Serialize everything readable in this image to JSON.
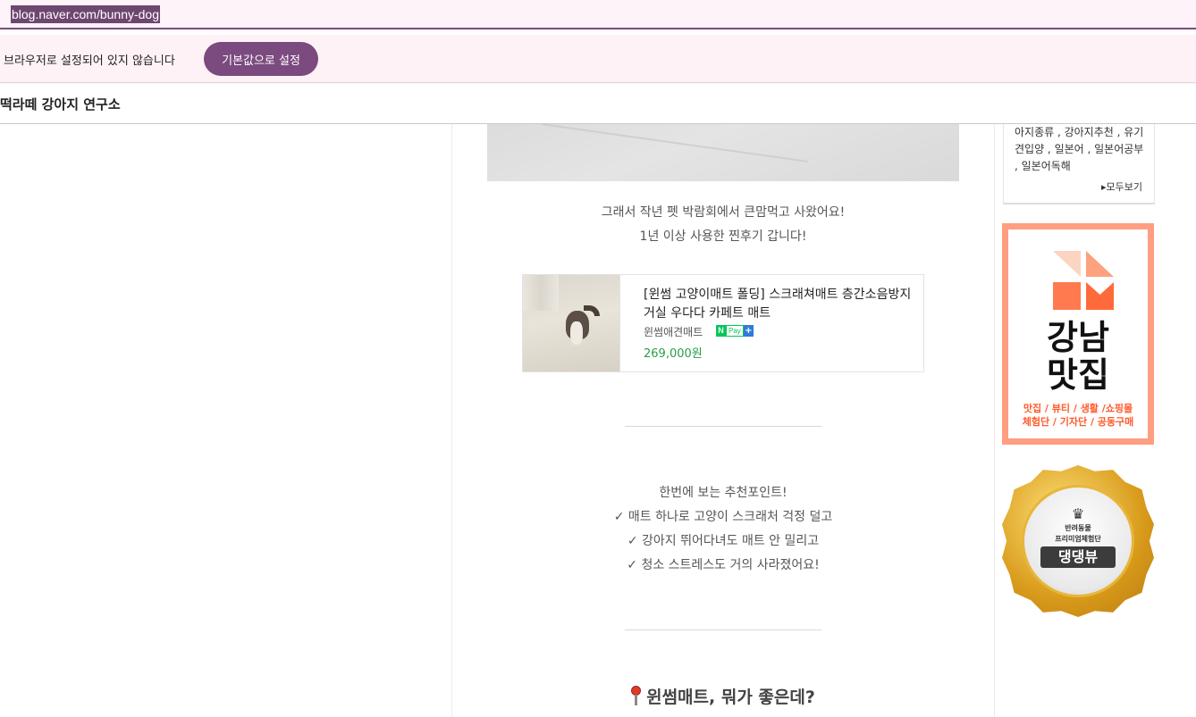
{
  "browser": {
    "url": "blog.naver.com/bunny-dog"
  },
  "banner": {
    "message": "브라우저로 설정되어 있지 않습니다",
    "button_label": "기본값으로 설정"
  },
  "blog": {
    "title": "떡라떼 강아지 연구소"
  },
  "post": {
    "intro_lines": [
      "그래서 작년 펫 박람회에서 큰맘먹고 사왔어요!",
      "1년 이상 사용한 찐후기 갑니다!"
    ],
    "product": {
      "title": "[윈썸 고양이매트 폴딩] 스크래쳐매트 층간소음방지 거실 우다다 카페트 매트",
      "store": "윈썸애견매트",
      "npay_n": "N",
      "npay_pay": "Pay",
      "npay_plus": "+",
      "price": "269,000원",
      "price_color": "#2a9d48"
    },
    "points_lines": [
      "한번에 보는 추천포인트!",
      "✓ 매트 하나로 고양이 스크래처 걱정 덜고",
      "✓ 강아지 뛰어다녀도 매트 안 밀리고",
      "✓ 청소 스트레스도 거의 사라졌어요!"
    ],
    "section_heading": "윈썸매트, 뭐가 좋은데?"
  },
  "sidebar": {
    "tags_text": "아지종류 , 강아지추천 , 유기견입양 , 일본어 , 일본어공부 , 일본어독해",
    "view_all": "▸모두보기",
    "ad": {
      "title_line1": "강남",
      "title_line2": "맛집",
      "sub_line1": "맛집 / 뷰티 / 생활 /쇼핑몰",
      "sub_line2": "체험단 / 기자단 / 공동구매",
      "accent_color": "#ff9e80"
    },
    "badge": {
      "crown": "♛",
      "line1": "반려동물",
      "line2": "프리미엄체험단",
      "ribbon": "댕댕뷰"
    }
  },
  "colors": {
    "accent": "#7b4a7f",
    "banner_bg": "#fff2f7"
  }
}
